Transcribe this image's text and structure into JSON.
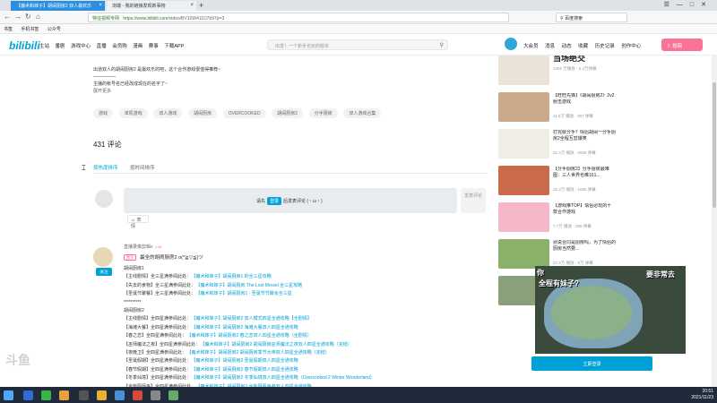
{
  "browser": {
    "tabs": [
      {
        "label": "【魔术和妹子】胡闹厨房2 双人最欢乐"
      },
      {
        "label": "浏端 - 我的链接发现新事物"
      }
    ],
    "new_tab": "+",
    "url": "https://www.bilibili.com",
    "url_path": "/video/BV10W411D7b97p=3",
    "url_prefix": "特征视频专网",
    "search_placeholder": "百度搜索",
    "bookmarks": [
      "书签",
      "手机书签",
      "公众号"
    ]
  },
  "site": {
    "logo": "bilibili",
    "topnav": [
      "主站",
      "番剧",
      "游戏中心",
      "直播",
      "会员购",
      "漫画",
      "赛事",
      "下载APP"
    ],
    "search_placeholder": "出发！一个新手也玩的版本",
    "rightnav": [
      "大会员",
      "消息",
      "动态",
      "收藏",
      "历史记录",
      "创作中心"
    ],
    "upload": "投稿"
  },
  "video": {
    "desc_lines": [
      "出道双人的胡闹厨房2 是最欢乐的吧，这个合作游戏很值得推荐~",
      "—————",
      "主播的帐号名已经改成现在的名字了~",
      "展开更多"
    ],
    "tags": [
      "游戏",
      "单机游戏",
      "双人游戏",
      "胡闹厨房",
      "OVERCOOKED",
      "胡闹厨房2",
      "分手厨房",
      "双人游戏合集"
    ]
  },
  "comments": {
    "count": "431 评论",
    "sort_hot": "按热度排序",
    "sort_time": "按时间排序",
    "box_prefix": "请先",
    "login": "登录",
    "box_suffix": "后发表评论 (・ω・)",
    "post": "发表评论",
    "emoji": "表情",
    "first": {
      "user": "直播录像剪辑v",
      "level": "LV6",
      "pinned": "置顶",
      "top_text": "最全的胡闹厨房2 o(*≧▽≦)ツ",
      "follow": "关注",
      "lines": [
        {
          "a": "胡闹厨房1",
          "b": ""
        },
        {
          "a": "【主线剧情】全三星满参阅此处：",
          "b": "【魔术和妹子】胡闹厨房1 的全三星攻略"
        },
        {
          "a": "【失去的食物】全三星满参阅此处：",
          "b": "【魔术和妹子】胡闹厨房 The Lost Morsel 全三星攻略"
        },
        {
          "a": "【圣诞节聚餐】全三星满参阅此处：",
          "b": "【魔术和妹子】胡闹厨房1 - 圣诞节节聚会全三星"
        },
        {
          "a": "**********",
          "b": ""
        },
        {
          "a": "胡闹厨房2",
          "b": ""
        },
        {
          "a": "【主线剧情】全四星满参阅此处：",
          "b": "【魔术和妹子】胡闹厨房2 双人模式四星全通攻略【全剧情】"
        },
        {
          "a": "【海滩大餐】全四星满参阅此处：",
          "b": "【魔术和妹子】胡闹厨房2 海滩大餐双人四星全通攻略"
        },
        {
          "a": "【春之恋】全四星满参阅此处：",
          "b": "【魔术和妹子】胡闹厨房2 春之恋双人四星全通攻略（全剧情）"
        },
        {
          "a": "【巫师魔法之夜】全四星满参阅此处：",
          "b": "【魔术和妹子】胡闹厨房2 胡闹厨房巫师魔法之夜双人四星全通攻略（完结）"
        },
        {
          "a": "【夜晚卫】全四星满参阅此处：",
          "b": "【魔术和妹子】胡闹厨房2 胡闹厨房季节大帝双人四星全通攻略（完结）"
        },
        {
          "a": "【圣诞假期】全四星满参阅此处：",
          "b": "【魔术和妹子】胡闹厨房2 圣诞假期双人四星全通攻略"
        },
        {
          "a": "【春节假期】全四星满参阅此处：",
          "b": "【魔术和妹子】胡闹厨房2 春节假期双人四星全通攻略"
        },
        {
          "a": "【冬季仙境】全四星满参阅此处：",
          "b": "【魔术和妹子】胡闹厨房2 冬季仙境双人四星全通攻略（Overcooked 2 Winter Wonderland）"
        },
        {
          "a": "【全能厨师争】全四星满参阅此处：",
          "b": "【魔术和妹子】胡闹厨房2 全能厨师争参双人四星全通攻略"
        }
      ]
    }
  },
  "sidebar": {
    "banner_text": "当场绝交",
    "banner_meta": "1402 万播放 · 6.2万弹幕",
    "items": [
      {
        "title": "【旺旺先锋】《胡闹厨房2》2v2 射击游戏",
        "meta": "11.6万 播放 · 307 弹幕"
      },
      {
        "title": "打完就分手？情侣胡闹一分手厨房2全程互怼爆笑",
        "meta": "31.3万 播放 · 2006 弹幕"
      },
      {
        "title": "【分手厨房2】分手厨房最难图：三人世界也难161...",
        "meta": "15.3万 播放 · 1096 弹幕"
      },
      {
        "title": "【游戏推TOP】情侣必玩的十款合作游戏",
        "meta": "7.7万 播放 · 358 弹幕"
      },
      {
        "title": "别说合同是厨房吗，为了情侣的厨房当然要...",
        "meta": "37.4万 播放 · 5万 弹幕"
      },
      {
        "title": "【OVERCOOKED2】最好玩的厨房游戏...",
        "meta": "4万 播放 · 91 弹幕"
      }
    ]
  },
  "floating_video": {
    "text_left": "你",
    "text_top": "全程有妹子?",
    "text_right": "要非常去",
    "watch_btn": "立即登录"
  },
  "taskbar": {
    "time": "20:51",
    "date": "2021/11/23"
  },
  "watermark": "斗鱼",
  "colors": {
    "accent": "#00a1d6",
    "pink": "#fb7299",
    "taskbar": "#1f2a3a"
  }
}
